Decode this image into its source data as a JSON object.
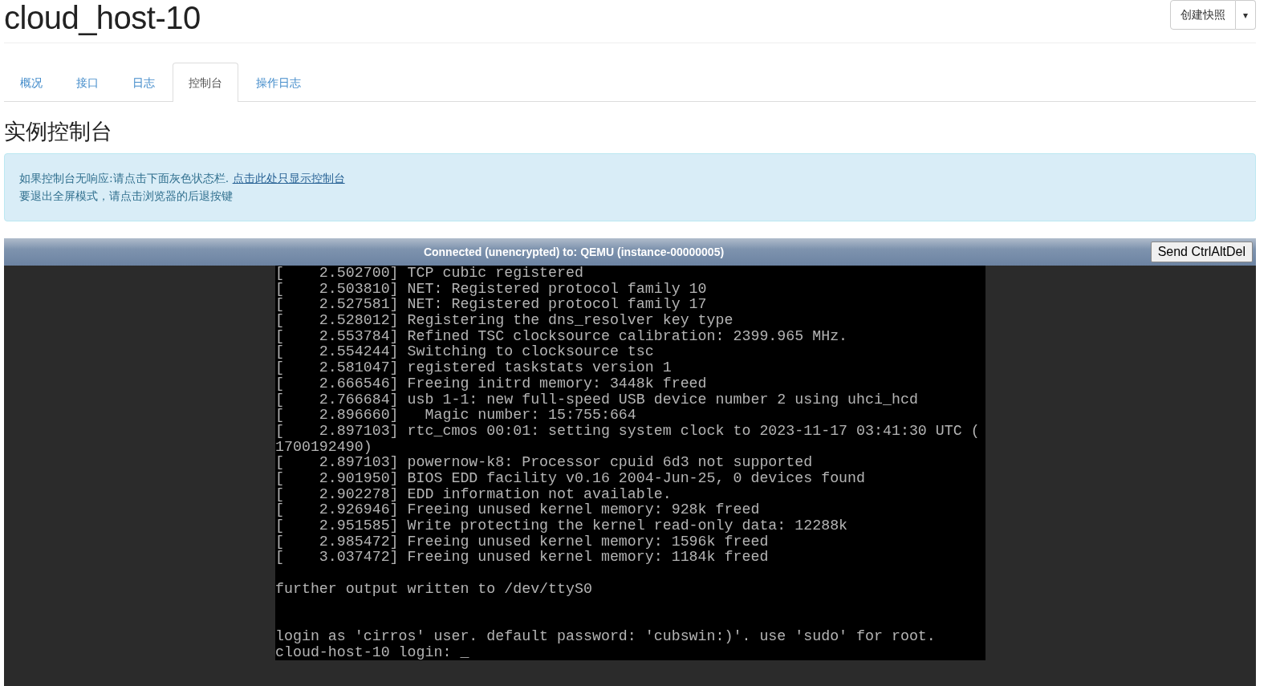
{
  "page": {
    "title": "cloud_host-10",
    "actions": {
      "primary": "创建快照",
      "dropdown": "▾"
    }
  },
  "tabs": [
    {
      "label": "概况",
      "selected": false
    },
    {
      "label": "接口",
      "selected": false
    },
    {
      "label": "日志",
      "selected": false
    },
    {
      "label": "控制台",
      "selected": true
    },
    {
      "label": "操作日志",
      "selected": false
    }
  ],
  "section_title": "实例控制台",
  "alert": {
    "lines": [
      {
        "text": "如果控制台无响应:请点击下面灰色状态栏.",
        "link": "点击此处只显示控制台"
      },
      {
        "text": "要退出全屏模式，请点击浏览器的后退按键"
      }
    ]
  },
  "console": {
    "status": "Connected (unencrypted) to: QEMU (instance-00000005)",
    "button": "Send CtrlAltDel",
    "lines": [
      {
        "kind": "line",
        "text": "[    2.502700] TCP cubic registered"
      },
      {
        "kind": "line",
        "text": "[    2.503810] NET: Registered protocol family 10"
      },
      {
        "kind": "line",
        "text": "[    2.527581] NET: Registered protocol family 17"
      },
      {
        "kind": "line",
        "text": "[    2.528012] Registering the dns_resolver key type"
      },
      {
        "kind": "line",
        "text": "[    2.553784] Refined TSC clocksource calibration: 2399.965 MHz."
      },
      {
        "kind": "line",
        "text": "[    2.554244] Switching to clocksource tsc"
      },
      {
        "kind": "line",
        "text": "[    2.581047] registered taskstats version 1"
      },
      {
        "kind": "line",
        "text": "[    2.666546] Freeing initrd memory: 3448k freed"
      },
      {
        "kind": "line",
        "text": "[    2.766684] usb 1-1: new full-speed USB device number 2 using uhci_hcd"
      },
      {
        "kind": "line",
        "text": "[    2.896660]   Magic number: 15:755:664"
      },
      {
        "kind": "line",
        "text": "[    2.897103] rtc_cmos 00:01: setting system clock to 2023-11-17 03:41:30 UTC ("
      },
      {
        "kind": "line",
        "text": "1700192490)"
      },
      {
        "kind": "line",
        "text": "[    2.897103] powernow-k8: Processor cpuid 6d3 not supported"
      },
      {
        "kind": "line",
        "text": "[    2.901950] BIOS EDD facility v0.16 2004-Jun-25, 0 devices found"
      },
      {
        "kind": "line",
        "text": "[    2.902278] EDD information not available."
      },
      {
        "kind": "line",
        "text": "[    2.926946] Freeing unused kernel memory: 928k freed"
      },
      {
        "kind": "line",
        "text": "[    2.951585] Write protecting the kernel read-only data: 12288k"
      },
      {
        "kind": "line",
        "text": "[    2.985472] Freeing unused kernel memory: 1596k freed"
      },
      {
        "kind": "line",
        "text": "[    3.037472] Freeing unused kernel memory: 1184k freed"
      },
      {
        "kind": "blank"
      },
      {
        "kind": "line",
        "text": "further output written to /dev/ttyS0"
      },
      {
        "kind": "blank"
      },
      {
        "kind": "blank"
      },
      {
        "kind": "line",
        "text": "login as 'cirros' user. default password: 'cubswin:)'. use 'sudo' for root."
      },
      {
        "kind": "line",
        "text": "cloud-host-10 login: _"
      }
    ]
  }
}
